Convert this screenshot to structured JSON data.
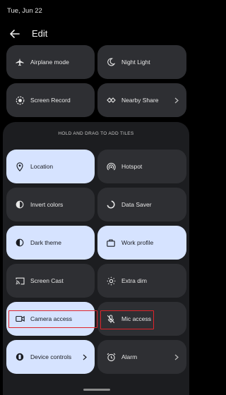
{
  "status": {
    "date": "Tue, Jun 22"
  },
  "header": {
    "title": "Edit"
  },
  "active_tiles": [
    {
      "label": "Airplane mode",
      "icon": "airplane-icon"
    },
    {
      "label": "Night Light",
      "icon": "moon-icon"
    },
    {
      "label": "Screen Record",
      "icon": "screen-record-icon"
    },
    {
      "label": "Nearby Share",
      "icon": "nearby-share-icon",
      "has_chevron": true
    }
  ],
  "available": {
    "hint": "HOLD AND DRAG TO ADD TILES",
    "tiles": [
      {
        "label": "Location",
        "icon": "location-pin-icon",
        "active": true
      },
      {
        "label": "Hotspot",
        "icon": "hotspot-icon",
        "active": false
      },
      {
        "label": "Invert colors",
        "icon": "invert-colors-icon",
        "active": false
      },
      {
        "label": "Data Saver",
        "icon": "data-saver-icon",
        "active": false
      },
      {
        "label": "Dark theme",
        "icon": "dark-theme-icon",
        "active": true
      },
      {
        "label": "Work profile",
        "icon": "briefcase-icon",
        "active": true
      },
      {
        "label": "Screen Cast",
        "icon": "cast-icon",
        "active": false
      },
      {
        "label": "Extra dim",
        "icon": "extra-dim-icon",
        "active": false
      },
      {
        "label": "Camera access",
        "icon": "camera-icon",
        "active": true,
        "highlighted": true
      },
      {
        "label": "Mic access",
        "icon": "mic-off-icon",
        "active": false,
        "highlighted": true
      },
      {
        "label": "Device controls",
        "icon": "device-controls-icon",
        "active": true,
        "has_chevron": true
      },
      {
        "label": "Alarm",
        "icon": "alarm-icon",
        "active": false,
        "has_chevron": true
      }
    ]
  },
  "colors": {
    "background": "#000000",
    "tile_inactive": "#2e2f33",
    "tile_active": "#d6e3ff",
    "panel": "#1c1d20",
    "highlight": "#e0242a"
  }
}
